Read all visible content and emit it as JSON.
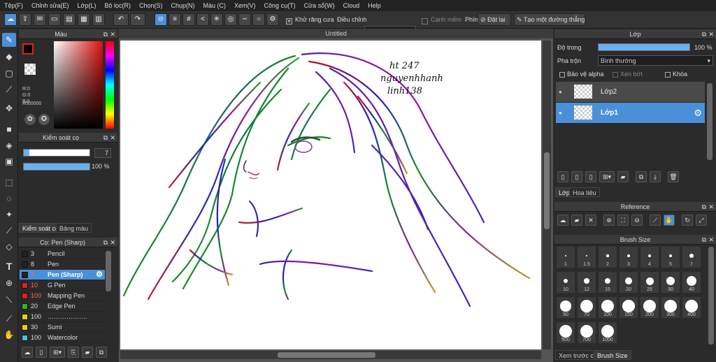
{
  "menu": [
    "Tệp(F)",
    "Chỉnh sửa(E)",
    "Lớp(L)",
    "Bộ lọc(R)",
    "Chọn(S)",
    "Chụp(N)",
    "Màu (C)",
    "Xem(V)",
    "Công cụ(T)",
    "Cửa sổ(W)",
    "Cloud",
    "Help"
  ],
  "toolbar": {
    "antialias_label": "Khử răng cưa",
    "adjust_label": "Điều chỉnh",
    "adjust_value": "40",
    "edge_label": "Cạnh mềm",
    "key_label": "Phím",
    "reset_label": "Đặt lại",
    "straight_line_label": "Tạo một đường thẳng"
  },
  "color_panel": {
    "title": "Màu",
    "r": "R:0",
    "g": "G:0",
    "b": "B:0",
    "hex": "#000000"
  },
  "brush_control": {
    "title": "Kiểm soát cọ",
    "size": "7",
    "opacity": "100 %",
    "size_fraction": 0.08,
    "opacity_fraction": 1.0,
    "tab_control": "Kiểm soát cọ",
    "tab_palette": "Bảng màu"
  },
  "brush_list": {
    "title": "Cọ: Pen (Sharp)",
    "items": [
      {
        "size": "3",
        "name": "Pencil",
        "color": "#222222"
      },
      {
        "size": "8",
        "name": "Pen",
        "color": "#222222"
      },
      {
        "size": "7",
        "name": "Pen (Sharp)",
        "color": "#222222"
      },
      {
        "size": "10",
        "name": "G Pen",
        "color": "#e02020"
      },
      {
        "size": "100",
        "name": "Mapping Pen",
        "color": "#e02020"
      },
      {
        "size": "20",
        "name": "Edge Pen",
        "color": "#20c020"
      },
      {
        "size": "100",
        "name": "……………….",
        "color": "#e0d020"
      },
      {
        "size": "30",
        "name": "Sumi",
        "color": "#e0d020"
      },
      {
        "size": "100",
        "name": "Watercolor",
        "color": "#40c0e0"
      }
    ]
  },
  "canvas": {
    "tab": "Untitled",
    "signature": [
      "ht 247",
      "nguyenhhanh",
      "linh138"
    ]
  },
  "layer_panel": {
    "title": "Lớp",
    "opacity_label": "Độ trong",
    "opacity_value": "100 %",
    "opacity_fraction": 1.0,
    "blend_label": "Pha trộn",
    "blend_value": "Bình thường",
    "protect_alpha": "Bảo vệ alpha",
    "clipping": "Xén bớt",
    "lock": "Khóa",
    "layers": [
      "Lớp2",
      "Lớp1"
    ],
    "tab_layer": "Lớp",
    "tab_texture": "Hoa tiêu"
  },
  "reference": {
    "title": "Reference"
  },
  "brush_size": {
    "title": "Brush Size",
    "sizes": [
      "1",
      "1.5",
      "2",
      "3",
      "4",
      "5",
      "7",
      "10",
      "12",
      "15",
      "20",
      "25",
      "30",
      "40",
      "50",
      "70",
      "100",
      "150",
      "200",
      "300",
      "400",
      "500",
      "700",
      "1000"
    ],
    "tab_preview": "Xem trước cọ",
    "tab_size": "Brush Size"
  }
}
